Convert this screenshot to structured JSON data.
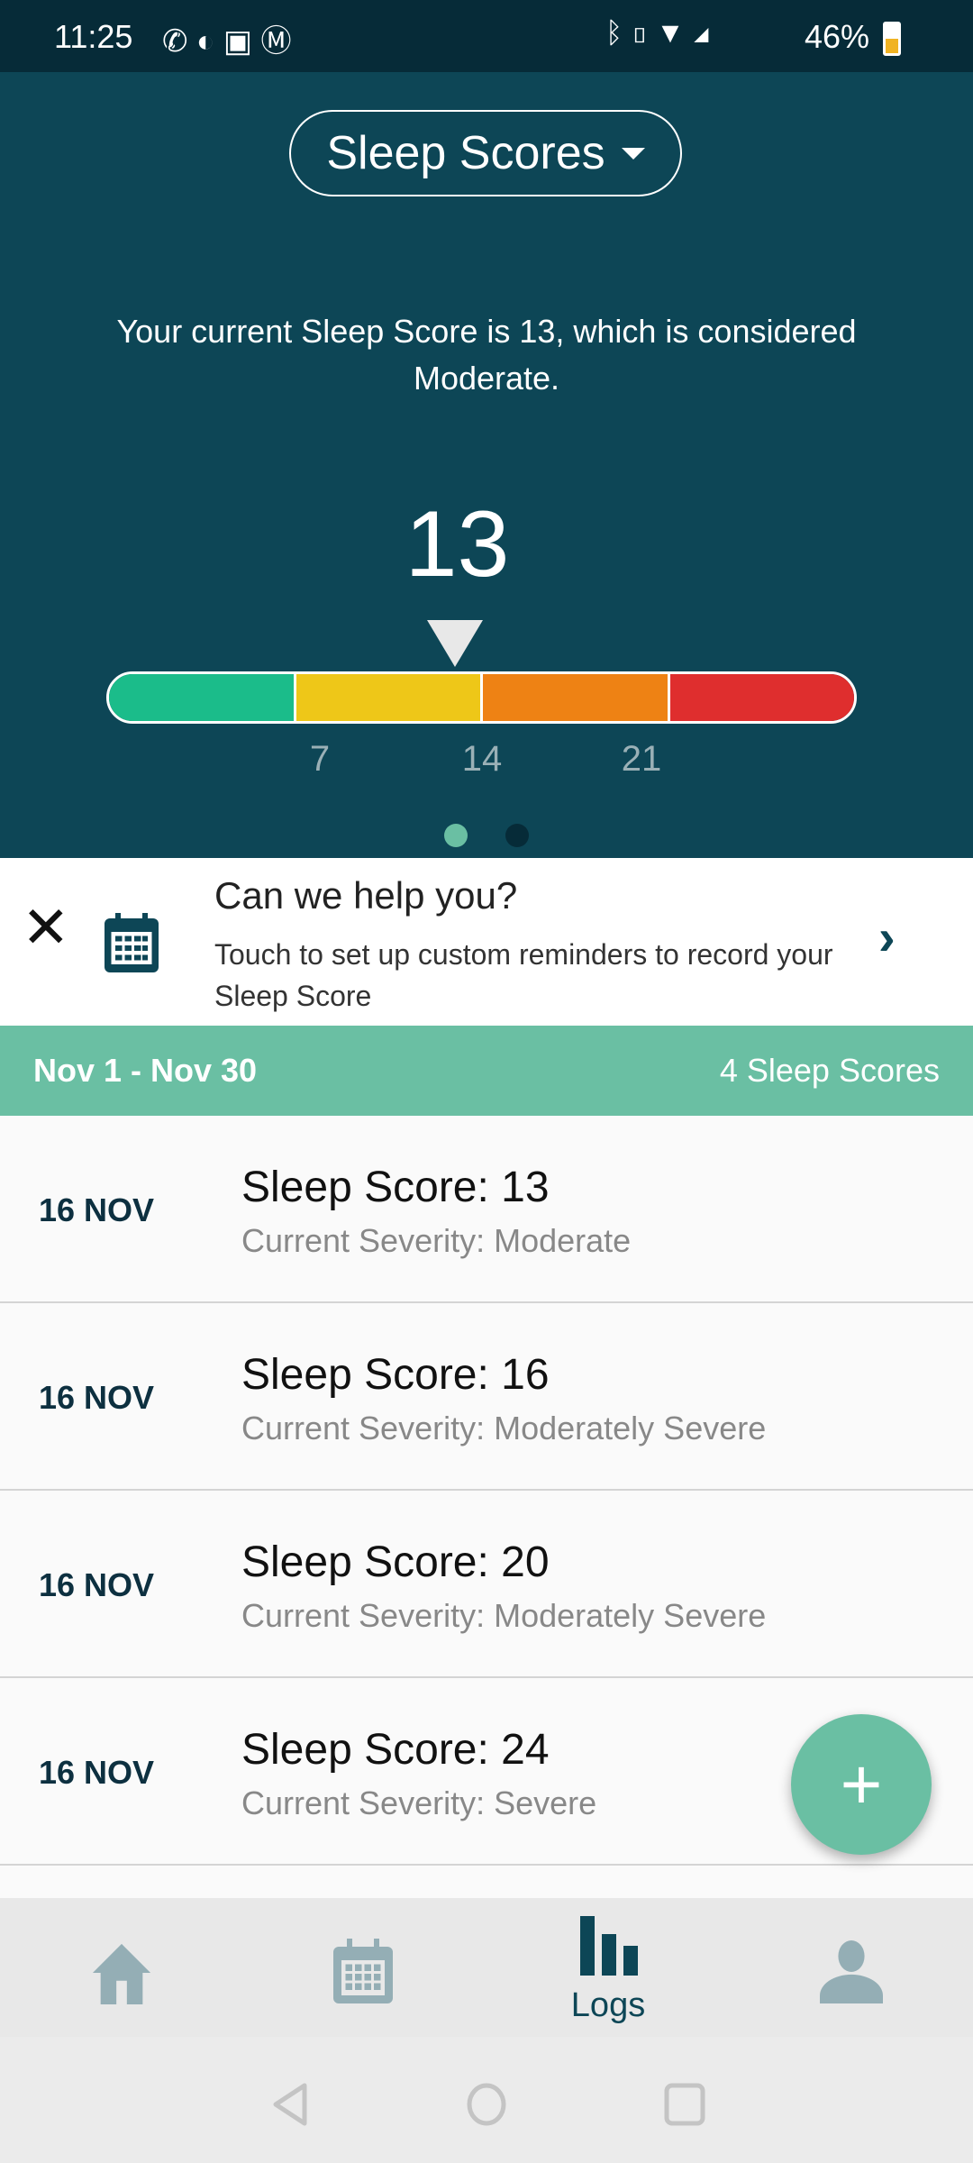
{
  "status_bar": {
    "time": "11:25",
    "battery": "46%",
    "icons": [
      "whatsapp-icon",
      "c-icon",
      "outlook-icon",
      "m-icon",
      "bluetooth-icon",
      "vibrate-icon",
      "wifi-icon",
      "signal-icon",
      "battery-charging-icon"
    ]
  },
  "header": {
    "dropdown_label": "Sleep Scores",
    "description": "Your current Sleep Score is 13, which is considered Moderate.",
    "current_score": "13",
    "scale": {
      "value": 13,
      "min": 0,
      "max": 28,
      "ticks": [
        "7",
        "14",
        "21"
      ],
      "segment_colors": [
        "#1bbc8a",
        "#eec718",
        "#ee8214",
        "#df2e2e"
      ]
    },
    "page_dots": {
      "count": 2,
      "active": 0
    }
  },
  "help_card": {
    "title": "Can we help you?",
    "body": "Touch to set up custom reminders to record your Sleep Score"
  },
  "range_band": {
    "range": "Nov 1 - Nov 30",
    "count": "4 Sleep Scores"
  },
  "entries": [
    {
      "date": "16 NOV",
      "title": "Sleep Score: 13",
      "severity": "Current Severity: Moderate"
    },
    {
      "date": "16 NOV",
      "title": "Sleep Score: 16",
      "severity": "Current Severity: Moderately Severe"
    },
    {
      "date": "16 NOV",
      "title": "Sleep Score: 20",
      "severity": "Current Severity: Moderately Severe"
    },
    {
      "date": "16 NOV",
      "title": "Sleep Score: 24",
      "severity": "Current Severity: Severe"
    }
  ],
  "fab": "+",
  "bottom_nav": {
    "items": [
      {
        "icon": "home-icon"
      },
      {
        "icon": "calendar-icon"
      },
      {
        "icon": "bar-chart-icon",
        "label": "Logs",
        "active": true
      },
      {
        "icon": "person-icon"
      }
    ]
  },
  "colors": {
    "header": "#0d4656",
    "accent": "#6abfa3",
    "inactive_icon": "#94aeb5"
  }
}
